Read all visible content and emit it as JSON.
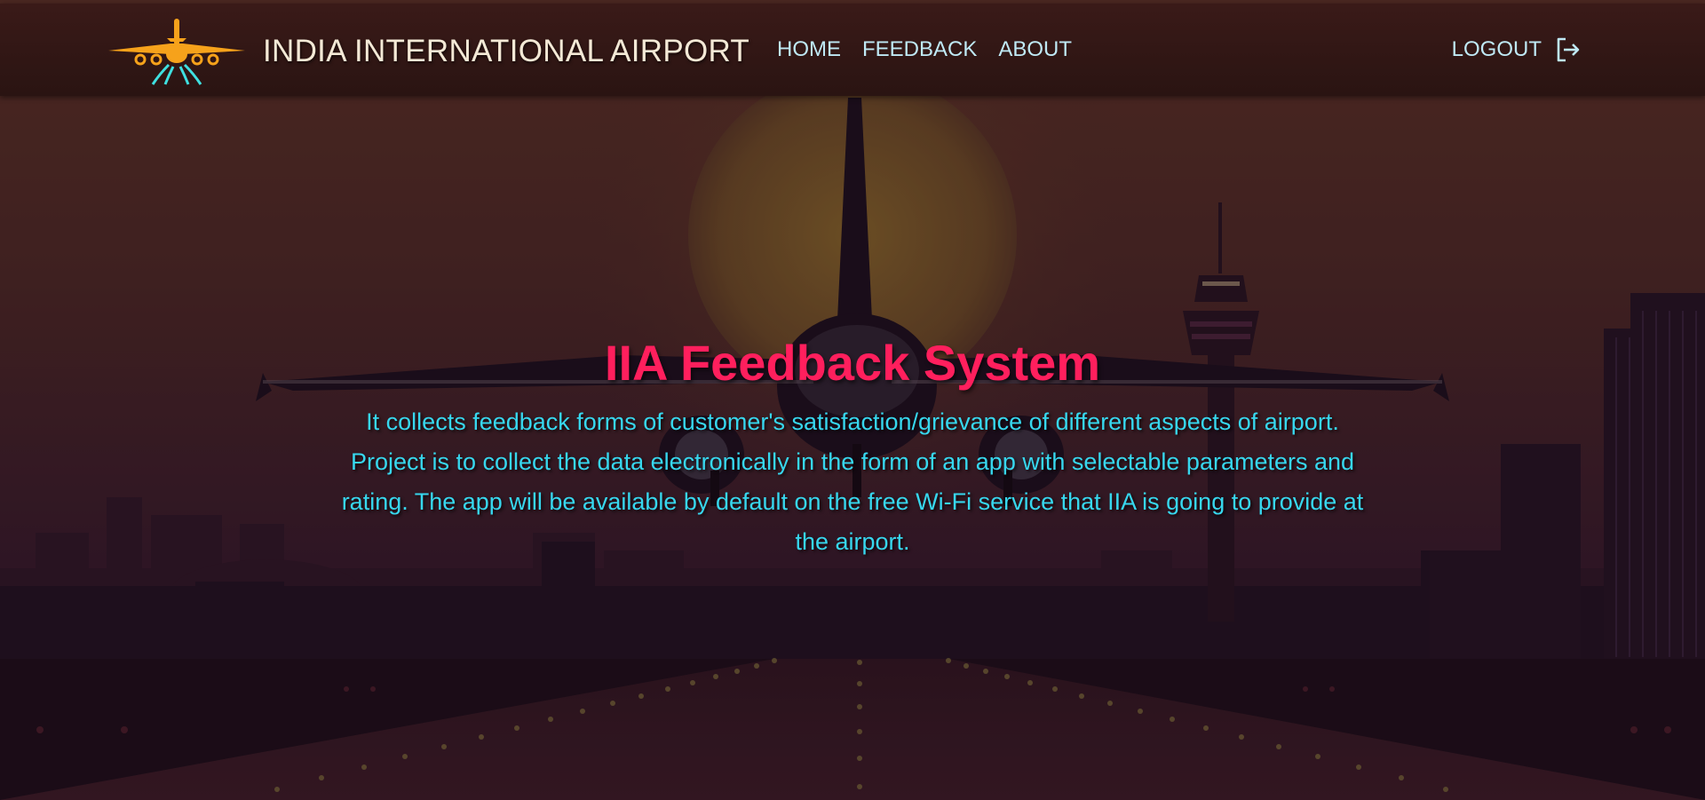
{
  "header": {
    "title": "INDIA INTERNATIONAL AIRPORT",
    "logo_icon": "airplane-logo-icon",
    "nav": [
      {
        "label": "HOME"
      },
      {
        "label": "FEEDBACK"
      },
      {
        "label": "ABOUT"
      }
    ],
    "logout_label": "LOGOUT",
    "logout_icon": "logout-icon"
  },
  "hero": {
    "title": "IIA Feedback System",
    "description": "It collects feedback forms of customer's satisfaction/grievance of different aspects of airport. Project is to collect the data electronically in the form of an app with selectable parameters and rating. The app will be available by default on the free Wi-Fi service that IIA is going to provide at the airport."
  },
  "colors": {
    "title_accent": "#ff1f5d",
    "description_text": "#37d7ee",
    "nav_text": "#bfe9f5",
    "header_bg": "#2a1412",
    "logo_orange": "#f6a21b",
    "logo_cyan": "#3fe0e0"
  }
}
